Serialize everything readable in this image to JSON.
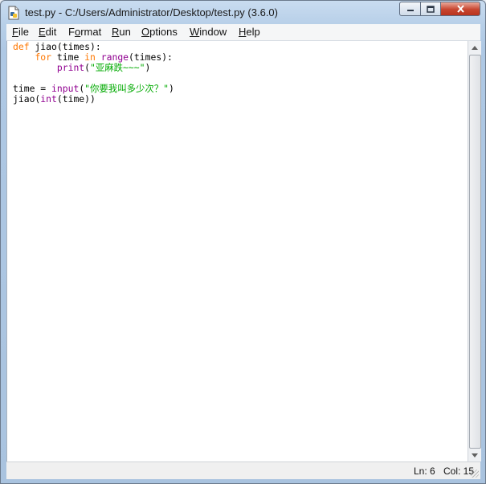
{
  "window": {
    "title": "test.py - C:/Users/Administrator/Desktop/test.py (3.6.0)",
    "icon": "python-idle-file-icon",
    "controls": {
      "minimize": "minimize-icon",
      "maximize": "maximize-icon",
      "close": "close-icon"
    }
  },
  "menu": {
    "items": [
      {
        "u": "F",
        "rest": "ile"
      },
      {
        "u": "E",
        "rest": "dit"
      },
      {
        "pre": "F",
        "u": "o",
        "rest": "rmat"
      },
      {
        "u": "R",
        "rest": "un"
      },
      {
        "u": "O",
        "rest": "ptions"
      },
      {
        "u": "W",
        "rest": "indow"
      },
      {
        "u": "H",
        "rest": "elp"
      }
    ]
  },
  "editor": {
    "lines": [
      [
        {
          "t": "def",
          "c": "kw"
        },
        {
          "t": " jiao(times):",
          "c": ""
        }
      ],
      [
        {
          "t": "    ",
          "c": ""
        },
        {
          "t": "for",
          "c": "kw"
        },
        {
          "t": " time ",
          "c": ""
        },
        {
          "t": "in",
          "c": "kw"
        },
        {
          "t": " ",
          "c": ""
        },
        {
          "t": "range",
          "c": "bi"
        },
        {
          "t": "(times):",
          "c": ""
        }
      ],
      [
        {
          "t": "        ",
          "c": ""
        },
        {
          "t": "print",
          "c": "bi"
        },
        {
          "t": "(",
          "c": ""
        },
        {
          "t": "\"亚麻跌~~~\"",
          "c": "str"
        },
        {
          "t": ")",
          "c": ""
        }
      ],
      [],
      [
        {
          "t": "time = ",
          "c": ""
        },
        {
          "t": "input",
          "c": "bi"
        },
        {
          "t": "(",
          "c": ""
        },
        {
          "t": "\"你要我叫多少次？\"",
          "c": "str"
        },
        {
          "t": ")",
          "c": ""
        }
      ],
      [
        {
          "t": "jiao(",
          "c": ""
        },
        {
          "t": "int",
          "c": "bi"
        },
        {
          "t": "(time))",
          "c": ""
        }
      ]
    ]
  },
  "status": {
    "ln": "Ln: 6",
    "col": "Col: 15"
  },
  "colors": {
    "keyword": "#ff7700",
    "builtin": "#900090",
    "string": "#00aa00"
  }
}
